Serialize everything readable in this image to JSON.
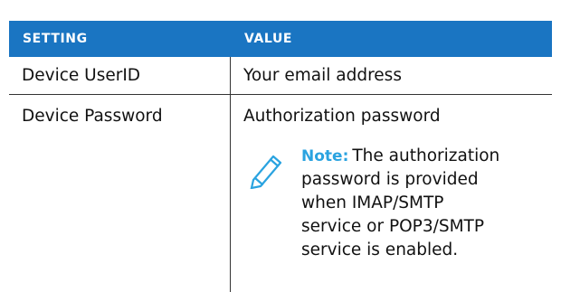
{
  "table": {
    "headers": [
      "SETTING",
      "VALUE"
    ],
    "rows": [
      {
        "setting": "Device UserID",
        "value": "Your email address"
      },
      {
        "setting": "Device Password",
        "value": "Authorization password"
      }
    ],
    "note": {
      "label": "Note:",
      "lines": [
        "The authorization",
        "password is provided",
        "when IMAP/SMTP",
        "service or POP3/SMTP",
        "service is enabled."
      ],
      "icon": "pencil-icon"
    },
    "colors": {
      "header_bg": "#1a75c2",
      "header_text": "#ffffff",
      "note_label": "#2aa3e0",
      "border": "#333333"
    }
  }
}
